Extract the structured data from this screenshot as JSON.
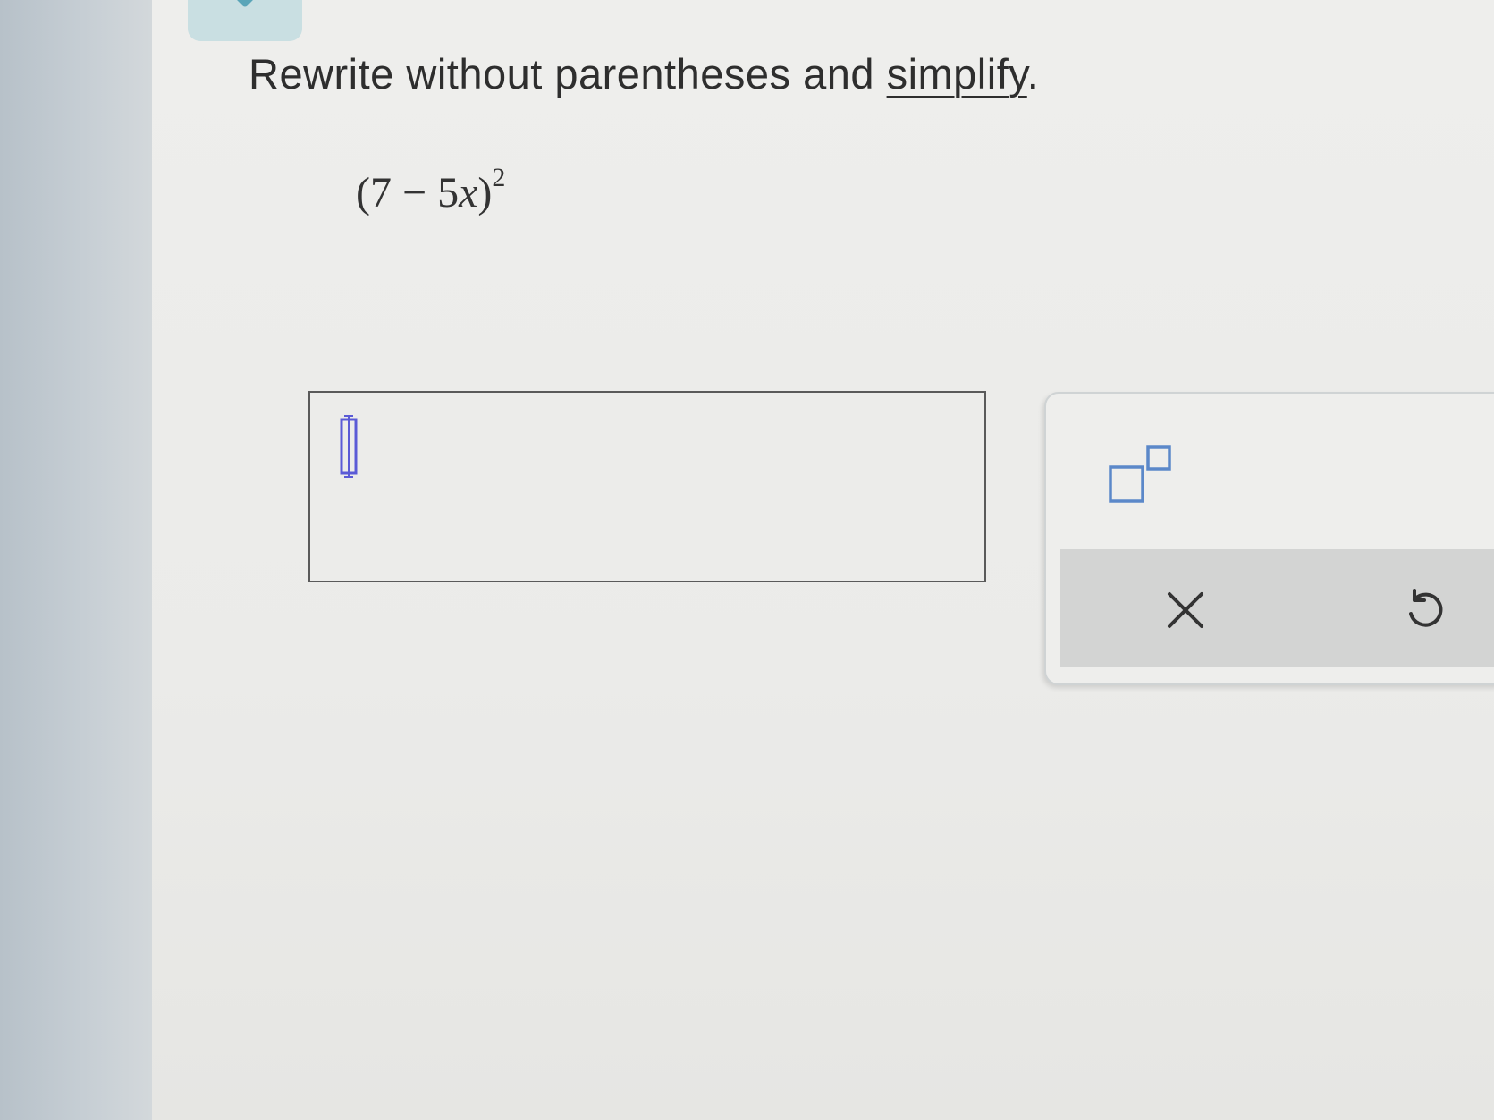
{
  "question": {
    "prompt_prefix": "Rewrite without parentheses and ",
    "prompt_link": "simplify",
    "prompt_suffix": ".",
    "expression": {
      "open": "(",
      "constant": "7",
      "operator": " − ",
      "coefficient": "5",
      "variable": "x",
      "close": ")",
      "exponent": "2"
    }
  },
  "answer": {
    "value": ""
  },
  "keypad": {
    "buttons": [
      {
        "name": "exponent",
        "icon": "superscript-template-icon"
      },
      {
        "name": "clear",
        "icon": "close-icon"
      },
      {
        "name": "undo",
        "icon": "undo-icon"
      }
    ]
  },
  "colors": {
    "accent": "#5aa5b8",
    "cursor": "#5b5bd6",
    "template_box": "#5b88c9",
    "icon": "#333333"
  }
}
